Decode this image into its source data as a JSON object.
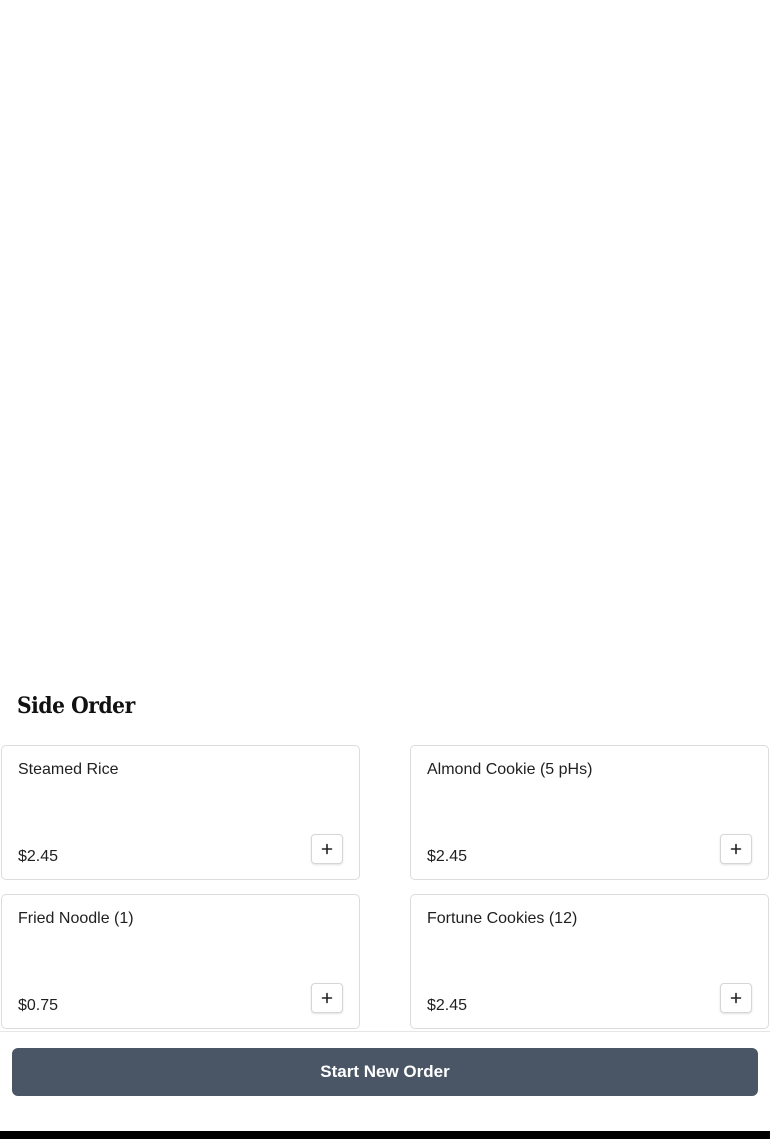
{
  "section": {
    "title": "Side Order"
  },
  "items": [
    {
      "name": "Steamed Rice",
      "price": "$2.45",
      "add_icon": "plus-icon"
    },
    {
      "name": "Almond Cookie (5 pHs)",
      "price": "$2.45",
      "add_icon": "plus-icon"
    },
    {
      "name": "Fried Noodle (1)",
      "price": "$0.75",
      "add_icon": "plus-icon"
    },
    {
      "name": "Fortune Cookies (12)",
      "price": "$2.45",
      "add_icon": "plus-icon"
    }
  ],
  "actions": {
    "start_new_order_label": "Start New Order"
  },
  "colors": {
    "primary_button": "#4a5565",
    "card_border": "#dcdcdc",
    "footer": "#000000"
  }
}
